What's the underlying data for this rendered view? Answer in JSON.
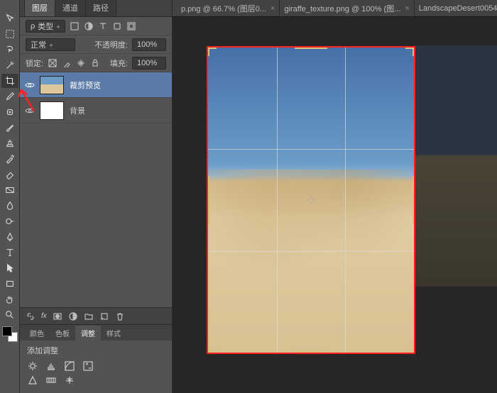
{
  "panel": {
    "tabs": [
      "图层",
      "通道",
      "路径"
    ],
    "filter_label": "类型",
    "blend_mode": "正常",
    "opacity_label": "不透明度:",
    "opacity_value": "100%",
    "lock_label": "锁定:",
    "fill_label": "填充:",
    "fill_value": "100%"
  },
  "layers": [
    {
      "name": "裁剪预览",
      "selected": true,
      "visible": true,
      "thumb": "desert"
    },
    {
      "name": "背景",
      "selected": false,
      "visible": true,
      "thumb": "white"
    }
  ],
  "adjustments": {
    "tabs": [
      "颜色",
      "色板",
      "调整",
      "样式"
    ],
    "title": "添加调整"
  },
  "documents": [
    {
      "label": "p.png @ 66.7% (图层0...",
      "active": false,
      "has_close": true
    },
    {
      "label": "giraffe_texture.png @ 100% (图...",
      "active": false,
      "has_close": true
    },
    {
      "label": "LandscapeDesert0054",
      "active": true,
      "has_close": false
    }
  ],
  "tools": [
    "move-tool",
    "marquee-tool",
    "lasso-tool",
    "magic-wand-tool",
    "crop-tool",
    "eyedropper-tool",
    "spot-heal-tool",
    "brush-tool",
    "clone-stamp-tool",
    "history-brush-tool",
    "eraser-tool",
    "gradient-tool",
    "blur-tool",
    "dodge-tool",
    "pen-tool",
    "type-tool",
    "path-select-tool",
    "rectangle-tool",
    "hand-tool",
    "zoom-tool"
  ],
  "layer_bottom_icons": [
    "link-icon",
    "fx-icon",
    "mask-icon",
    "adjustment-icon",
    "group-icon",
    "new-icon",
    "trash-icon"
  ],
  "filter_icons": [
    "image-filter-icon",
    "adjustment-filter-icon",
    "type-filter-icon",
    "shape-filter-icon",
    "smart-filter-icon"
  ],
  "lock_icons": [
    "lock-transparency-icon",
    "lock-image-icon",
    "lock-position-icon",
    "lock-all-icon"
  ],
  "adjustment_icons_row1": [
    "brightness-icon",
    "levels-icon",
    "curves-icon",
    "exposure-icon"
  ],
  "adjustment_icons_row2": [
    "vibrance-icon",
    "hue-icon",
    "color-balance-icon"
  ]
}
